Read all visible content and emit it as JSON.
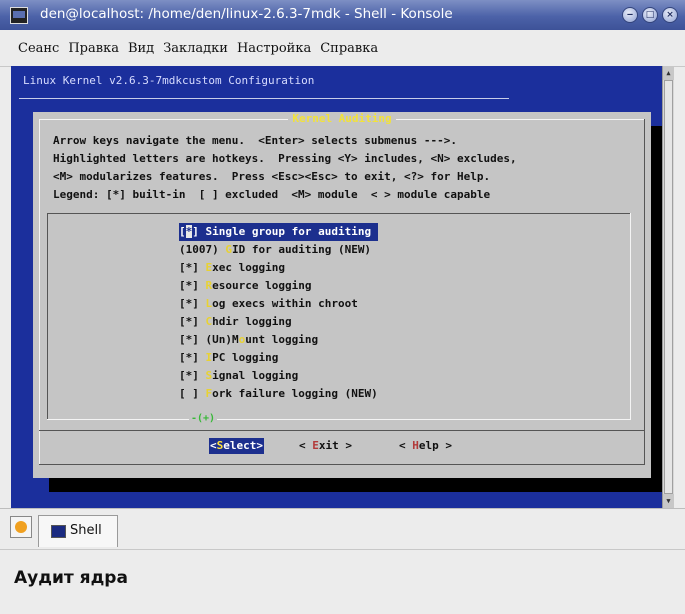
{
  "window": {
    "title": "den@localhost: /home/den/linux-2.6.3-7mdk - Shell - Konsole"
  },
  "menu": [
    "Сеанс",
    "Правка",
    "Вид",
    "Закладки",
    "Настройка",
    "Справка"
  ],
  "terminal": {
    "header": "Linux Kernel v2.6.3-7mdkcustom Configuration",
    "dialog_title": "Kernel Auditing",
    "instructions": [
      "Arrow keys navigate the menu.  <Enter> selects submenus --->.",
      "Highlighted letters are hotkeys.  Pressing <Y> includes, <N> excludes,",
      "<M> modularizes features.  Press <Esc><Esc> to exit, <?> for Help.",
      "Legend: [*] built-in  [ ] excluded  <M> module  < > module capable"
    ],
    "items": [
      {
        "prefix": "[",
        "cursor": "*",
        "mid": "] ",
        "hotkey": "S",
        "rest": "ingle group for auditing",
        "selected": true
      },
      {
        "prefix": "(1007) ",
        "hotkey": "G",
        "rest": "ID for auditing (NEW)"
      },
      {
        "prefix": "[*] ",
        "hotkey": "E",
        "rest": "xec logging"
      },
      {
        "prefix": "[*] ",
        "hotkey": "R",
        "rest": "esource logging"
      },
      {
        "prefix": "[*] ",
        "hotkey": "L",
        "rest": "og execs within chroot"
      },
      {
        "prefix": "[*] ",
        "hotkey": "C",
        "rest": "hdir logging"
      },
      {
        "prefix": "[*] (Un)M",
        "hotkey": "o",
        "rest": "unt logging"
      },
      {
        "prefix": "[*] ",
        "hotkey": "I",
        "rest": "PC logging"
      },
      {
        "prefix": "[*] ",
        "hotkey": "S",
        "rest": "ignal logging"
      },
      {
        "prefix": "[ ] ",
        "hotkey": "F",
        "rest": "ork failure logging (NEW)"
      }
    ],
    "more_indicator": "-(+)",
    "buttons": {
      "select": {
        "open": "<",
        "hotkey": "S",
        "rest": "elect>"
      },
      "exit": {
        "open": "< ",
        "hotkey": "E",
        "rest": "xit >"
      },
      "help": {
        "open": "< ",
        "hotkey": "H",
        "rest": "elp >"
      }
    }
  },
  "tabs": [
    {
      "label": "Shell"
    }
  ],
  "caption": "Аудит ядра"
}
